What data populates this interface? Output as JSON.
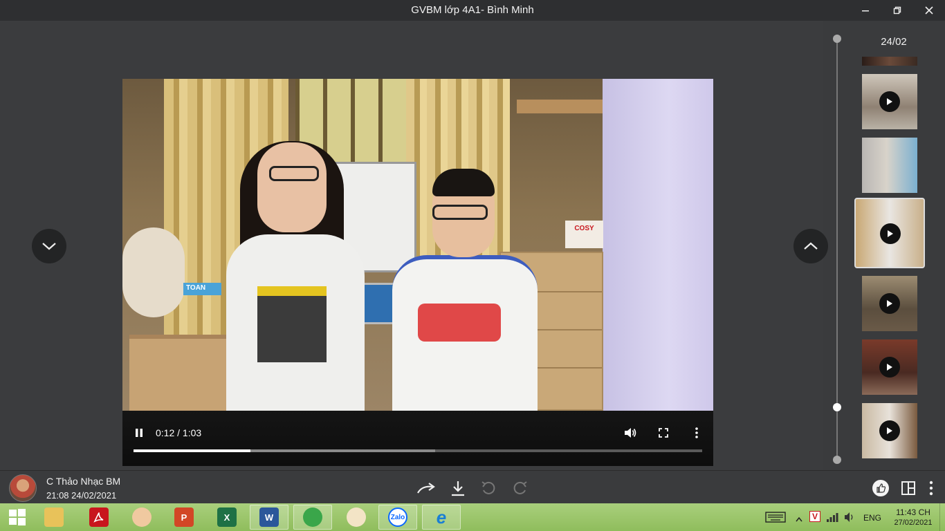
{
  "window": {
    "title": "GVBM lớp 4A1- Bình Minh",
    "minimize_icon": "minimize-icon",
    "maximize_icon": "restore-icon",
    "close_icon": "close-icon"
  },
  "player": {
    "time": "0:12 / 1:03",
    "played_fraction": 0.205,
    "buffered_fraction": 0.53,
    "scene_labels": {
      "toan_box": "TOAN",
      "cosy_box": "COSY"
    }
  },
  "sidebar": {
    "date": "24/02",
    "thumbs": [
      "video-thumb",
      "video-thumb",
      "image-thumb",
      "video-thumb",
      "video-thumb",
      "video-thumb",
      "video-thumb"
    ]
  },
  "message": {
    "sender": "C Thảo Nhạc BM",
    "timestamp": "21:08 24/02/2021"
  },
  "taskbar": {
    "apps": [
      "start",
      "file-explorer",
      "acrobat",
      "game",
      "powerpoint",
      "excel",
      "word",
      "coccoc",
      "paint",
      "zalo",
      "internet-explorer"
    ],
    "zalo_label": "Zalo",
    "language": "ENG",
    "clock_time": "11:43 CH",
    "clock_date": "27/02/2021",
    "colors": {
      "zalo": "#0a68ff",
      "acrobat": "#c8161d",
      "excel": "#1e7145",
      "word": "#2b579a",
      "powerpoint": "#d24726"
    }
  }
}
